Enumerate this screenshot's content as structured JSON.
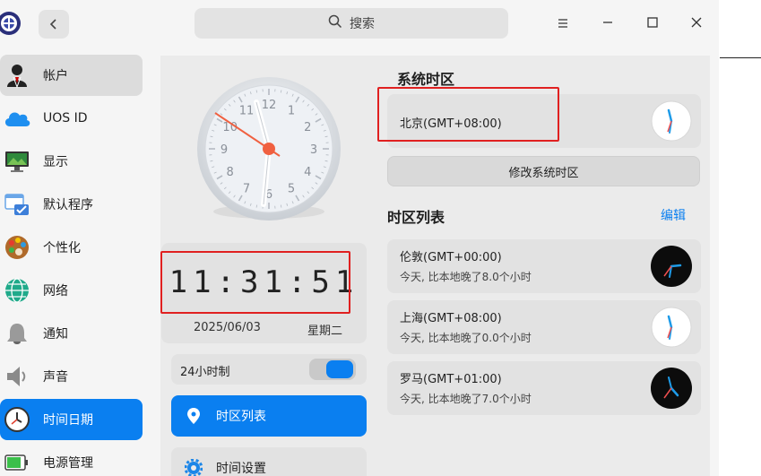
{
  "titlebar": {
    "search_placeholder": "搜索",
    "icons": [
      "app-logo-icon",
      "back-icon",
      "search-icon",
      "menu-icon",
      "minimize-icon",
      "maximize-icon",
      "close-icon"
    ]
  },
  "sidebar": {
    "items": [
      {
        "label": "帐户",
        "icon": "account-icon"
      },
      {
        "label": "UOS ID",
        "icon": "cloud-icon"
      },
      {
        "label": "显示",
        "icon": "display-icon"
      },
      {
        "label": "默认程序",
        "icon": "default-apps-icon"
      },
      {
        "label": "个性化",
        "icon": "personalization-icon"
      },
      {
        "label": "网络",
        "icon": "network-icon"
      },
      {
        "label": "通知",
        "icon": "bell-icon"
      },
      {
        "label": "声音",
        "icon": "speaker-icon"
      },
      {
        "label": "时间日期",
        "icon": "clock-icon"
      },
      {
        "label": "电源管理",
        "icon": "battery-icon"
      }
    ],
    "active_index": 8
  },
  "clock": {
    "analog_numbers": [
      "12",
      "1",
      "2",
      "3",
      "4",
      "5",
      "6",
      "7",
      "8",
      "9",
      "10",
      "11"
    ],
    "digital_time": "11:31:51",
    "date": "2025/06/03",
    "weekday": "星期二"
  },
  "settings": {
    "hour24_label": "24小时制",
    "hour24_on": true,
    "nav": [
      {
        "label": "时区列表",
        "icon": "location-pin-icon",
        "active": true
      },
      {
        "label": "时间设置",
        "icon": "gear-icon",
        "active": false
      }
    ]
  },
  "system_timezone": {
    "title": "系统时区",
    "city": "北京(GMT+08:00)",
    "change_button": "修改系统时区"
  },
  "timezone_list": {
    "title": "时区列表",
    "edit_label": "编辑",
    "items": [
      {
        "city": "伦敦(GMT+00:00)",
        "diff": "今天, 比本地晚了8.0个小时",
        "night": true
      },
      {
        "city": "上海(GMT+08:00)",
        "diff": "今天, 比本地晚了0.0个小时",
        "night": false
      },
      {
        "city": "罗马(GMT+01:00)",
        "diff": "今天, 比本地晚了7.0个小时",
        "night": true
      }
    ]
  },
  "colors": {
    "accent": "#0a7ff0",
    "highlight_box": "#e02020",
    "second_hand": "#f06040"
  }
}
